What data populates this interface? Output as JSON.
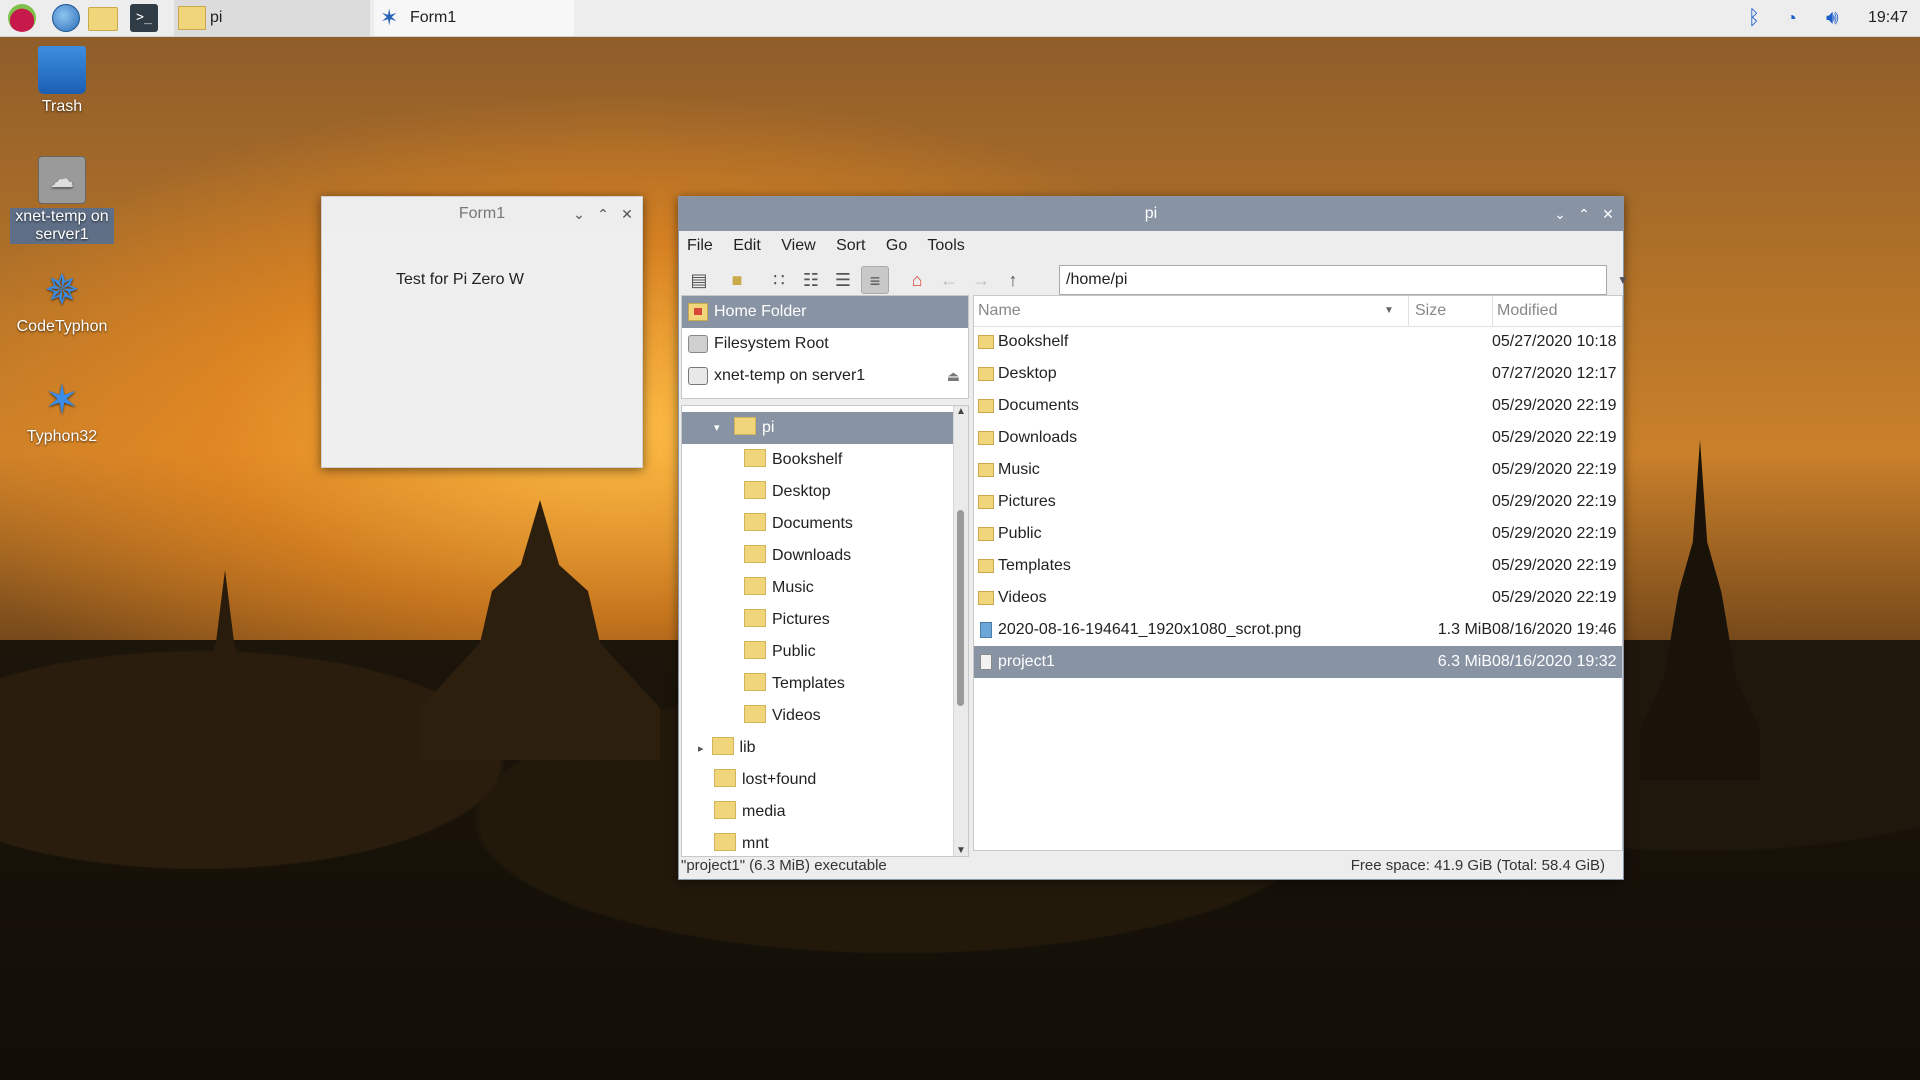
{
  "taskbar": {
    "tasks": [
      {
        "label": "pi"
      },
      {
        "label": "Form1"
      }
    ],
    "clock": "19:47"
  },
  "desktop": {
    "icons": [
      {
        "label": "Trash"
      },
      {
        "label": "xnet-temp on server1"
      },
      {
        "label": "CodeTyphon"
      },
      {
        "label": "Typhon32"
      }
    ]
  },
  "form1": {
    "title": "Form1",
    "label": "Test for Pi Zero W"
  },
  "file_manager": {
    "title": "pi",
    "menu": [
      "File",
      "Edit",
      "View",
      "Sort",
      "Go",
      "Tools"
    ],
    "path": "/home/pi",
    "places": [
      {
        "label": "Home Folder",
        "icon": "home-icon"
      },
      {
        "label": "Filesystem Root",
        "icon": "drive-icon"
      },
      {
        "label": "xnet-temp on server1",
        "icon": "network-drive-icon"
      }
    ],
    "tree": [
      {
        "label": "pi"
      },
      {
        "label": "Bookshelf"
      },
      {
        "label": "Desktop"
      },
      {
        "label": "Documents"
      },
      {
        "label": "Downloads"
      },
      {
        "label": "Music"
      },
      {
        "label": "Pictures"
      },
      {
        "label": "Public"
      },
      {
        "label": "Templates"
      },
      {
        "label": "Videos"
      },
      {
        "label": "lib"
      },
      {
        "label": "lost+found"
      },
      {
        "label": "media"
      },
      {
        "label": "mnt"
      }
    ],
    "columns": {
      "name": "Name",
      "size": "Size",
      "modified": "Modified"
    },
    "files": [
      {
        "name": "Bookshelf",
        "size": "",
        "modified": "05/27/2020 10:18"
      },
      {
        "name": "Desktop",
        "size": "",
        "modified": "07/27/2020 12:17"
      },
      {
        "name": "Documents",
        "size": "",
        "modified": "05/29/2020 22:19"
      },
      {
        "name": "Downloads",
        "size": "",
        "modified": "05/29/2020 22:19"
      },
      {
        "name": "Music",
        "size": "",
        "modified": "05/29/2020 22:19"
      },
      {
        "name": "Pictures",
        "size": "",
        "modified": "05/29/2020 22:19"
      },
      {
        "name": "Public",
        "size": "",
        "modified": "05/29/2020 22:19"
      },
      {
        "name": "Templates",
        "size": "",
        "modified": "05/29/2020 22:19"
      },
      {
        "name": "Videos",
        "size": "",
        "modified": "05/29/2020 22:19"
      },
      {
        "name": "2020-08-16-194641_1920x1080_scrot.png",
        "size": "1.3 MiB",
        "modified": "08/16/2020 19:46"
      },
      {
        "name": "project1",
        "size": "6.3 MiB",
        "modified": "08/16/2020 19:32"
      }
    ],
    "status_left": "\"project1\" (6.3 MiB) executable",
    "status_right": "Free space: 41.9 GiB (Total: 58.4 GiB)"
  },
  "colors": {
    "selection": "#8893a3",
    "taskbar": "#ededed",
    "folder": "#f0d57a"
  }
}
